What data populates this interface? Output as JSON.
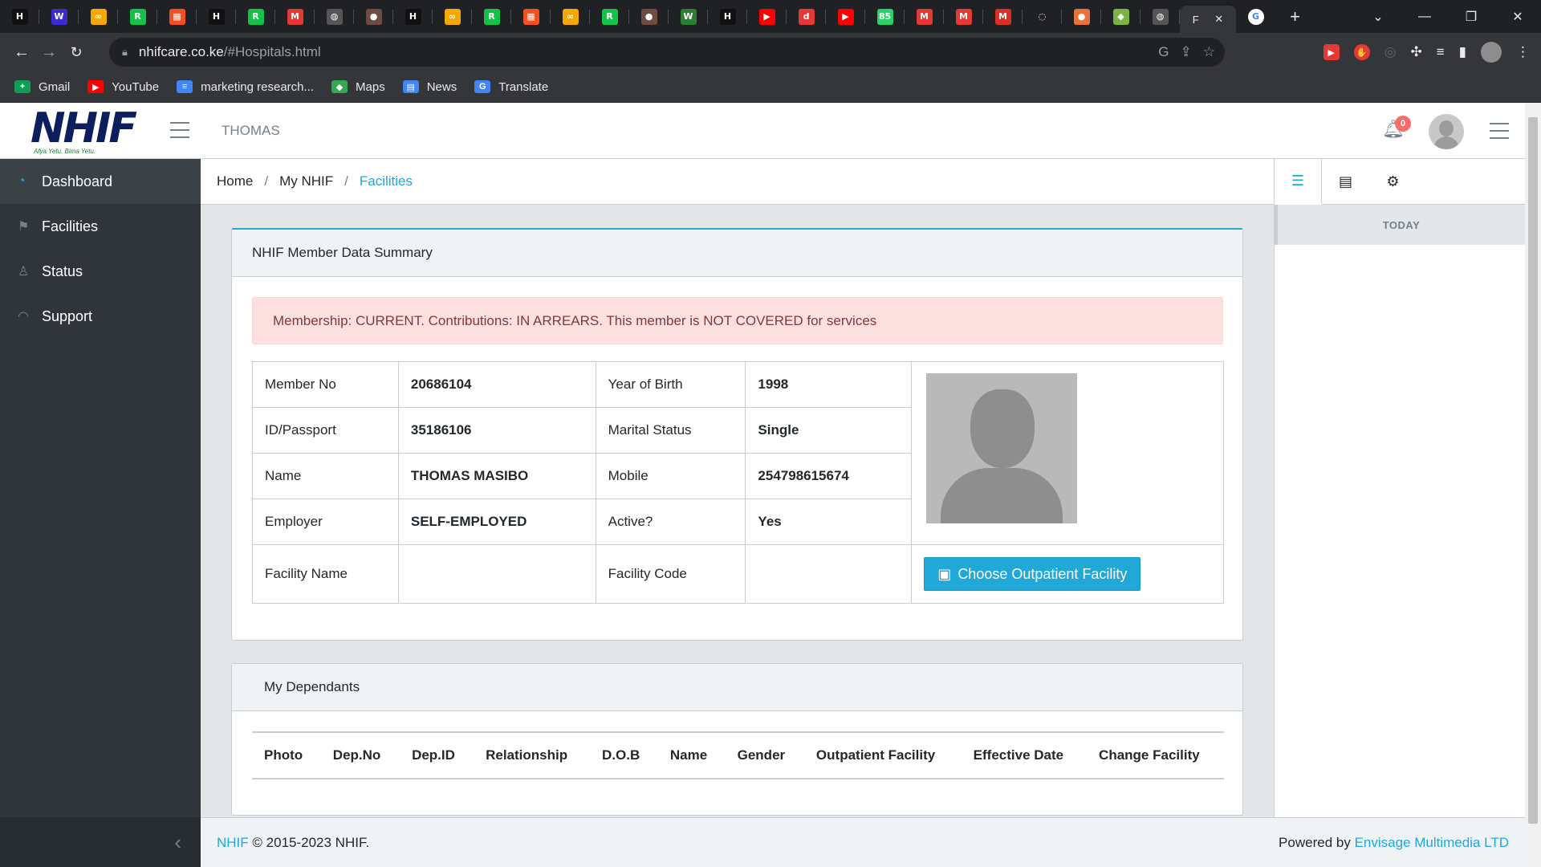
{
  "browser": {
    "tabs": [
      {
        "icon": "nhif-icon",
        "glyph": "H",
        "color": "#111111"
      },
      {
        "icon": "w-icon",
        "glyph": "W",
        "color": "#3d2bd1"
      },
      {
        "icon": "infinity-icon",
        "glyph": "∞",
        "color": "#f6a800"
      },
      {
        "icon": "rc-icon",
        "glyph": "R",
        "color": "#14c24a"
      },
      {
        "icon": "microsoft-icon",
        "glyph": "▦",
        "color": "#f25022"
      },
      {
        "icon": "nhif-icon",
        "glyph": "H",
        "color": "#111111"
      },
      {
        "icon": "rc-icon",
        "glyph": "R",
        "color": "#14c24a"
      },
      {
        "icon": "m-icon",
        "glyph": "M",
        "color": "#e53935"
      },
      {
        "icon": "globe-icon",
        "glyph": "◍",
        "color": "#555555"
      },
      {
        "icon": "avatar-icon",
        "glyph": "●",
        "color": "#6d4c41"
      },
      {
        "icon": "nhif-icon",
        "glyph": "H",
        "color": "#111111"
      },
      {
        "icon": "infinity-icon",
        "glyph": "∞",
        "color": "#f6a800"
      },
      {
        "icon": "rc-icon",
        "glyph": "R",
        "color": "#14c24a"
      },
      {
        "icon": "microsoft-icon",
        "glyph": "▦",
        "color": "#f25022"
      },
      {
        "icon": "infinity-icon",
        "glyph": "∞",
        "color": "#f6a800"
      },
      {
        "icon": "rc-icon",
        "glyph": "R",
        "color": "#14c24a"
      },
      {
        "icon": "avatar-icon",
        "glyph": "●",
        "color": "#6d4c41"
      },
      {
        "icon": "w-icon",
        "glyph": "W",
        "color": "#2e7d32"
      },
      {
        "icon": "nhif-icon",
        "glyph": "H",
        "color": "#111111"
      },
      {
        "icon": "youtube-icon",
        "glyph": "▶",
        "color": "#ff0000"
      },
      {
        "icon": "d-icon",
        "glyph": "d",
        "color": "#e53935"
      },
      {
        "icon": "youtube-icon",
        "glyph": "▶",
        "color": "#ff0000"
      },
      {
        "icon": "whatsapp-icon",
        "glyph": "85",
        "color": "#25d366"
      },
      {
        "icon": "m-icon",
        "glyph": "M",
        "color": "#e53935"
      },
      {
        "icon": "m-icon",
        "glyph": "M",
        "color": "#e53935"
      },
      {
        "icon": "gmail-icon",
        "glyph": "M",
        "color": "#d93025"
      },
      {
        "icon": "loading-icon",
        "glyph": "◌",
        "color": "#202124"
      },
      {
        "icon": "bird-icon",
        "glyph": "●",
        "color": "#e8723a"
      },
      {
        "icon": "shield-icon",
        "glyph": "◆",
        "color": "#7cb342"
      },
      {
        "icon": "globe-icon",
        "glyph": "◍",
        "color": "#555555"
      }
    ],
    "active_tab_label": "F",
    "close_glyph": "✕",
    "new_tab_glyph": "+",
    "url_host": "nhifcare.co.ke",
    "url_path": "/#Hospitals.html",
    "bookmarks": [
      {
        "label": "Gmail",
        "icon": "gmail-plus-icon",
        "color": "#0f9d58",
        "glyph": "+"
      },
      {
        "label": "YouTube",
        "icon": "youtube-icon",
        "color": "#ff0000",
        "glyph": "▶"
      },
      {
        "label": "marketing research...",
        "icon": "docs-icon",
        "color": "#4285f4",
        "glyph": "≡"
      },
      {
        "label": "Maps",
        "icon": "maps-icon",
        "color": "#34a853",
        "glyph": "◆"
      },
      {
        "label": "News",
        "icon": "news-icon",
        "color": "#4285f4",
        "glyph": "▤"
      },
      {
        "label": "Translate",
        "icon": "translate-icon",
        "color": "#4285f4",
        "glyph": "G"
      }
    ]
  },
  "header": {
    "logo_text": "NHIF",
    "logo_tagline": "Afya Yetu. Bima Yetu.",
    "user_name": "THOMAS",
    "notification_count": "0"
  },
  "sidebar": {
    "items": [
      {
        "label": "Dashboard",
        "icon": "speedometer-icon",
        "glyph": "◔",
        "active": true
      },
      {
        "label": "Facilities",
        "icon": "sign-icon",
        "glyph": "⚑",
        "active": false
      },
      {
        "label": "Status",
        "icon": "user-icon",
        "glyph": "♙",
        "active": false
      },
      {
        "label": "Support",
        "icon": "headphones-icon",
        "glyph": "◠",
        "active": false
      }
    ]
  },
  "breadcrumb": {
    "items": [
      "Home",
      "My NHIF"
    ],
    "current": "Facilities"
  },
  "aside": {
    "today_label": "TODAY"
  },
  "member_summary": {
    "title": "NHIF Member Data Summary",
    "alert": "Membership: CURRENT. Contributions: IN ARREARS. This member is NOT COVERED for services",
    "rows": [
      {
        "l1": "Member No",
        "v1": "20686104",
        "l2": "Year of Birth",
        "v2": "1998"
      },
      {
        "l1": "ID/Passport",
        "v1": "35186106",
        "l2": "Marital Status",
        "v2": "Single"
      },
      {
        "l1": "Name",
        "v1": "THOMAS MASIBO",
        "l2": "Mobile",
        "v2": "254798615674"
      },
      {
        "l1": "Employer",
        "v1": "SELF-EMPLOYED",
        "l2": "Active?",
        "v2": "Yes"
      },
      {
        "l1": "Facility Name",
        "v1": "",
        "l2": "Facility Code",
        "v2": ""
      }
    ],
    "choose_facility_label": "Choose Outpatient Facility"
  },
  "dependants": {
    "title": "My Dependants",
    "columns": [
      "Photo",
      "Dep.No",
      "Dep.ID",
      "Relationship",
      "D.O.B",
      "Name",
      "Gender",
      "Outpatient Facility",
      "Effective Date",
      "Change Facility"
    ]
  },
  "footer": {
    "brand_link": "NHIF",
    "copyright": "© 2015-2023 NHIF.",
    "powered_by": "Powered by",
    "vendor_link": "Envisage Multimedia LTD"
  }
}
